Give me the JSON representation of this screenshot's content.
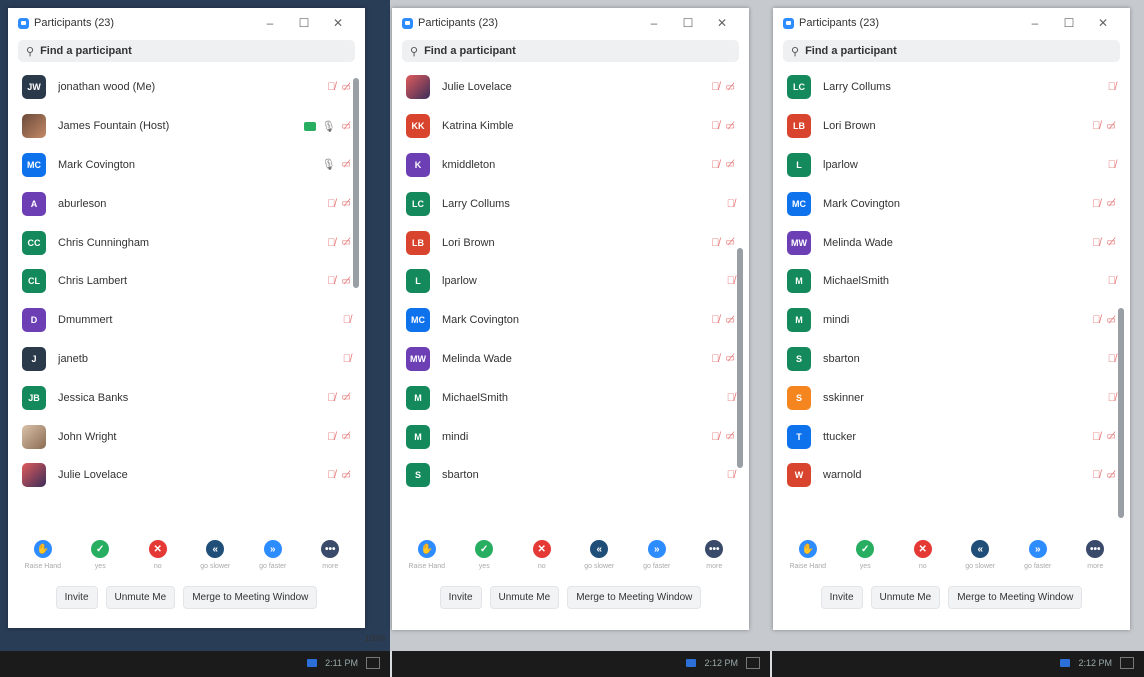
{
  "window_title": "Participants (23)",
  "search_placeholder": "Find a participant",
  "feedback": [
    {
      "label": "Raise Hand",
      "icon": "raise-hand-icon",
      "color": "#2d8cff",
      "glyph": "✋"
    },
    {
      "label": "yes",
      "icon": "yes-icon",
      "color": "#27ae60",
      "glyph": "✓"
    },
    {
      "label": "no",
      "icon": "no-icon",
      "color": "#e53935",
      "glyph": "✕"
    },
    {
      "label": "go slower",
      "icon": "go-slower-icon",
      "color": "#1f4e79",
      "glyph": "«"
    },
    {
      "label": "go faster",
      "icon": "go-faster-icon",
      "color": "#2d8cff",
      "glyph": "»"
    },
    {
      "label": "more",
      "icon": "more-icon",
      "color": "#3a4a6b",
      "glyph": "•••"
    }
  ],
  "buttons": {
    "invite": "Invite",
    "unmute": "Unmute Me",
    "merge": "Merge to Meeting Window"
  },
  "taskbar": {
    "time1": "2:11 PM",
    "time2": "2:12 PM",
    "time3": "2:12 PM",
    "zoom": "100%"
  },
  "windows": [
    {
      "participants": [
        {
          "initials": "JW",
          "name": "jonathan wood (Me)",
          "color": "#2b3a4a",
          "icons": "mute,cam"
        },
        {
          "initials": "",
          "name": "James Fountain (Host)",
          "color": "photo",
          "icons": "share,micon,cam"
        },
        {
          "initials": "MC",
          "name": "Mark Covington",
          "color": "#0e72ed",
          "icons": "micon,cam"
        },
        {
          "initials": "A",
          "name": "aburleson",
          "color": "#6c3fb5",
          "icons": "mute,cam"
        },
        {
          "initials": "CC",
          "name": "Chris Cunningham",
          "color": "#148a5c",
          "icons": "mute,cam"
        },
        {
          "initials": "CL",
          "name": "Chris Lambert",
          "color": "#148a5c",
          "icons": "mute,cam"
        },
        {
          "initials": "D",
          "name": "Dmummert",
          "color": "#6c3fb5",
          "icons": "mute"
        },
        {
          "initials": "J",
          "name": "janetb",
          "color": "#2b3a4a",
          "icons": "mute"
        },
        {
          "initials": "JB",
          "name": "Jessica Banks",
          "color": "#148a5c",
          "icons": "mute,cam"
        },
        {
          "initials": "",
          "name": "John Wright",
          "color": "photo2",
          "icons": "mute,cam"
        },
        {
          "initials": "",
          "name": "Julie Lovelace",
          "color": "photo3",
          "icons": "mute,cam"
        }
      ]
    },
    {
      "participants": [
        {
          "initials": "",
          "name": "Julie Lovelace",
          "color": "photo3",
          "icons": "mute,cam"
        },
        {
          "initials": "KK",
          "name": "Katrina Kimble",
          "color": "#d8442e",
          "icons": "mute,cam"
        },
        {
          "initials": "K",
          "name": "kmiddleton",
          "color": "#6c3fb5",
          "icons": "mute,cam"
        },
        {
          "initials": "LC",
          "name": "Larry Collums",
          "color": "#148a5c",
          "icons": "mute"
        },
        {
          "initials": "LB",
          "name": "Lori Brown",
          "color": "#d8442e",
          "icons": "mute,cam"
        },
        {
          "initials": "L",
          "name": "lparlow",
          "color": "#148a5c",
          "icons": "mute"
        },
        {
          "initials": "MC",
          "name": "Mark Covington",
          "color": "#0e72ed",
          "icons": "mute,cam"
        },
        {
          "initials": "MW",
          "name": "Melinda Wade",
          "color": "#6c3fb5",
          "icons": "mute,cam"
        },
        {
          "initials": "M",
          "name": "MichaelSmith",
          "color": "#148a5c",
          "icons": "mute"
        },
        {
          "initials": "M",
          "name": "mindi",
          "color": "#148a5c",
          "icons": "mute,cam"
        },
        {
          "initials": "S",
          "name": "sbarton",
          "color": "#148a5c",
          "icons": "mute"
        }
      ]
    },
    {
      "participants": [
        {
          "initials": "LC",
          "name": "Larry Collums",
          "color": "#148a5c",
          "icons": "mute"
        },
        {
          "initials": "LB",
          "name": "Lori Brown",
          "color": "#d8442e",
          "icons": "mute,cam"
        },
        {
          "initials": "L",
          "name": "lparlow",
          "color": "#148a5c",
          "icons": "mute"
        },
        {
          "initials": "MC",
          "name": "Mark Covington",
          "color": "#0e72ed",
          "icons": "mute,cam"
        },
        {
          "initials": "MW",
          "name": "Melinda Wade",
          "color": "#6c3fb5",
          "icons": "mute,cam"
        },
        {
          "initials": "M",
          "name": "MichaelSmith",
          "color": "#148a5c",
          "icons": "mute"
        },
        {
          "initials": "M",
          "name": "mindi",
          "color": "#148a5c",
          "icons": "mute,cam"
        },
        {
          "initials": "S",
          "name": "sbarton",
          "color": "#148a5c",
          "icons": "mute"
        },
        {
          "initials": "S",
          "name": "sskinner",
          "color": "#f5851f",
          "icons": "mute"
        },
        {
          "initials": "T",
          "name": "ttucker",
          "color": "#0e72ed",
          "icons": "mute,cam"
        },
        {
          "initials": "W",
          "name": "warnold",
          "color": "#d8442e",
          "icons": "mute,cam"
        }
      ]
    }
  ]
}
